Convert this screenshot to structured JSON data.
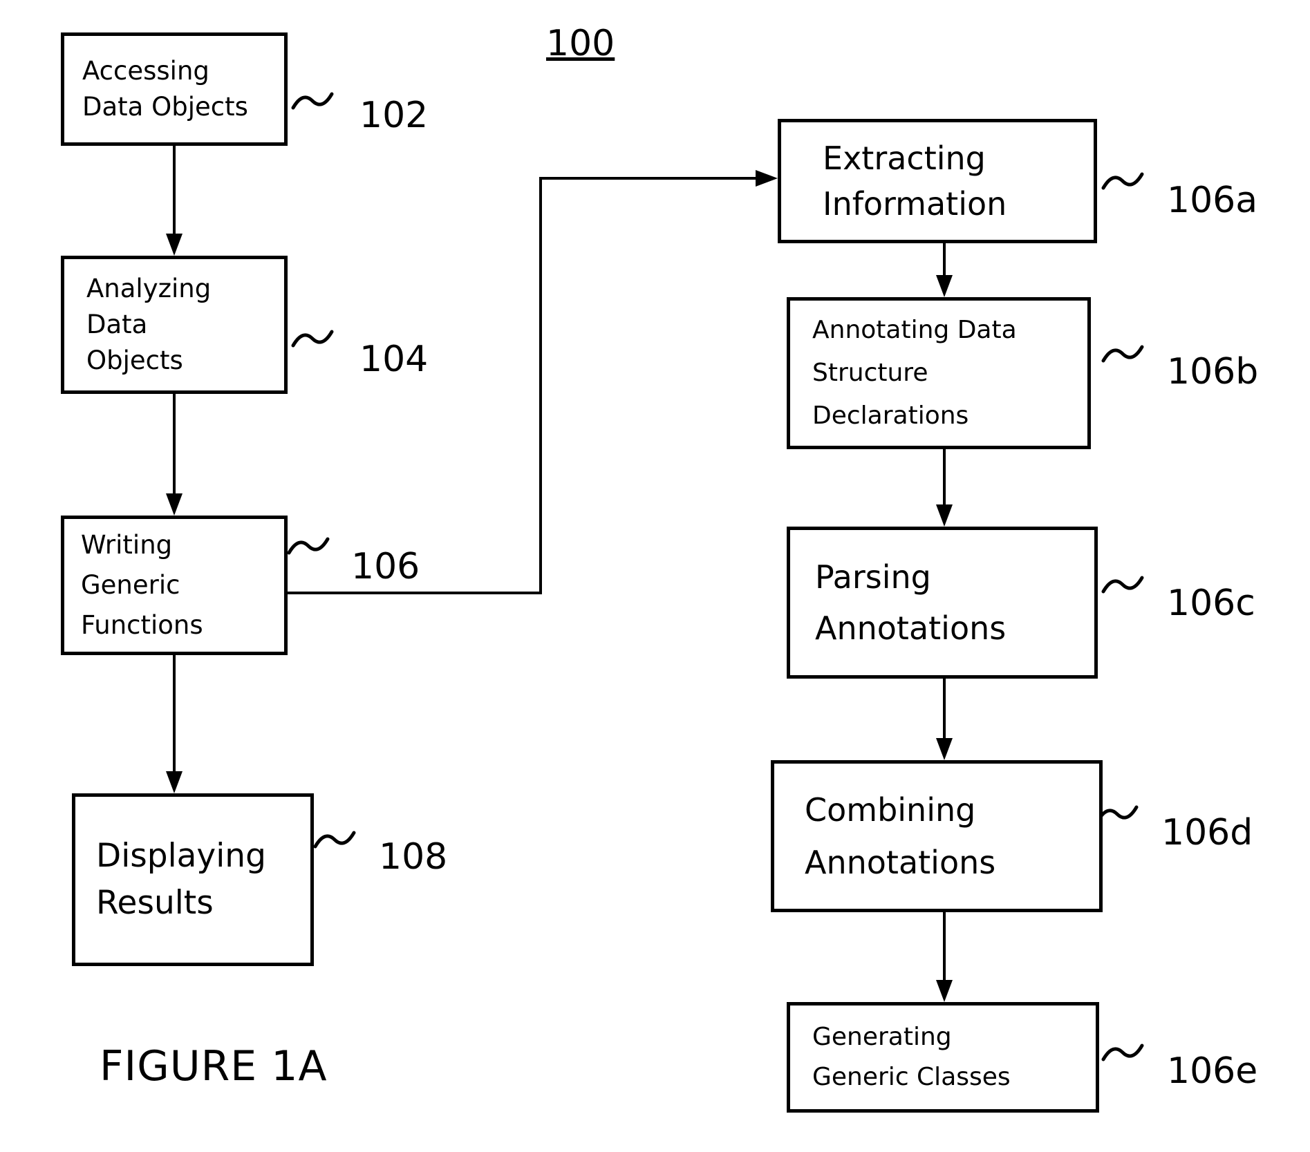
{
  "figure": {
    "number": "100",
    "title": "FIGURE 1A"
  },
  "left_flow": {
    "boxes": [
      {
        "id": "102",
        "lines": [
          "Accessing",
          "Data Objects"
        ],
        "ref": "102"
      },
      {
        "id": "104",
        "lines": [
          "Analyzing",
          "Data",
          "Objects"
        ],
        "ref": "104"
      },
      {
        "id": "106",
        "lines": [
          "Writing",
          "Generic",
          "Functions"
        ],
        "ref": "106"
      },
      {
        "id": "108",
        "lines": [
          "Displaying",
          "Results"
        ],
        "ref": "108"
      }
    ]
  },
  "right_flow": {
    "boxes": [
      {
        "id": "106a",
        "lines": [
          "Extracting",
          "Information"
        ],
        "ref": "106a"
      },
      {
        "id": "106b",
        "lines": [
          "Annotating Data",
          "Structure",
          "Declarations"
        ],
        "ref": "106b"
      },
      {
        "id": "106c",
        "lines": [
          "Parsing",
          "Annotations"
        ],
        "ref": "106c"
      },
      {
        "id": "106d",
        "lines": [
          "Combining",
          "Annotations"
        ],
        "ref": "106d"
      },
      {
        "id": "106e",
        "lines": [
          "Generating",
          "Generic Classes"
        ],
        "ref": "106e"
      }
    ]
  }
}
